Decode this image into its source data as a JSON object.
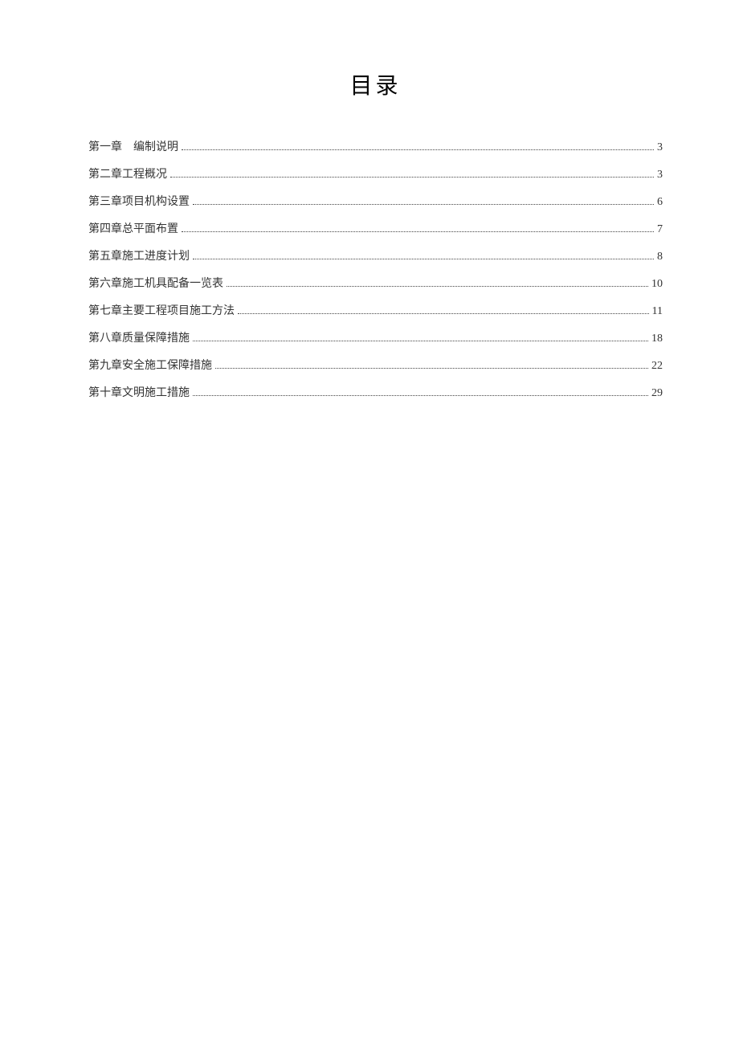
{
  "title": "目录",
  "toc": [
    {
      "label": "第一章　编制说明",
      "page": "3"
    },
    {
      "label": "第二章工程概况",
      "page": "3"
    },
    {
      "label": "第三章项目机构设置",
      "page": "6"
    },
    {
      "label": "第四章总平面布置",
      "page": "7"
    },
    {
      "label": "第五章施工进度计划",
      "page": "8"
    },
    {
      "label": "第六章施工机具配备一览表",
      "page": "10"
    },
    {
      "label": "第七章主要工程项目施工方法",
      "page": "11"
    },
    {
      "label": "第八章质量保障措施",
      "page": "18"
    },
    {
      "label": "第九章安全施工保障措施",
      "page": "22"
    },
    {
      "label": "第十章文明施工措施",
      "page": "29"
    }
  ]
}
